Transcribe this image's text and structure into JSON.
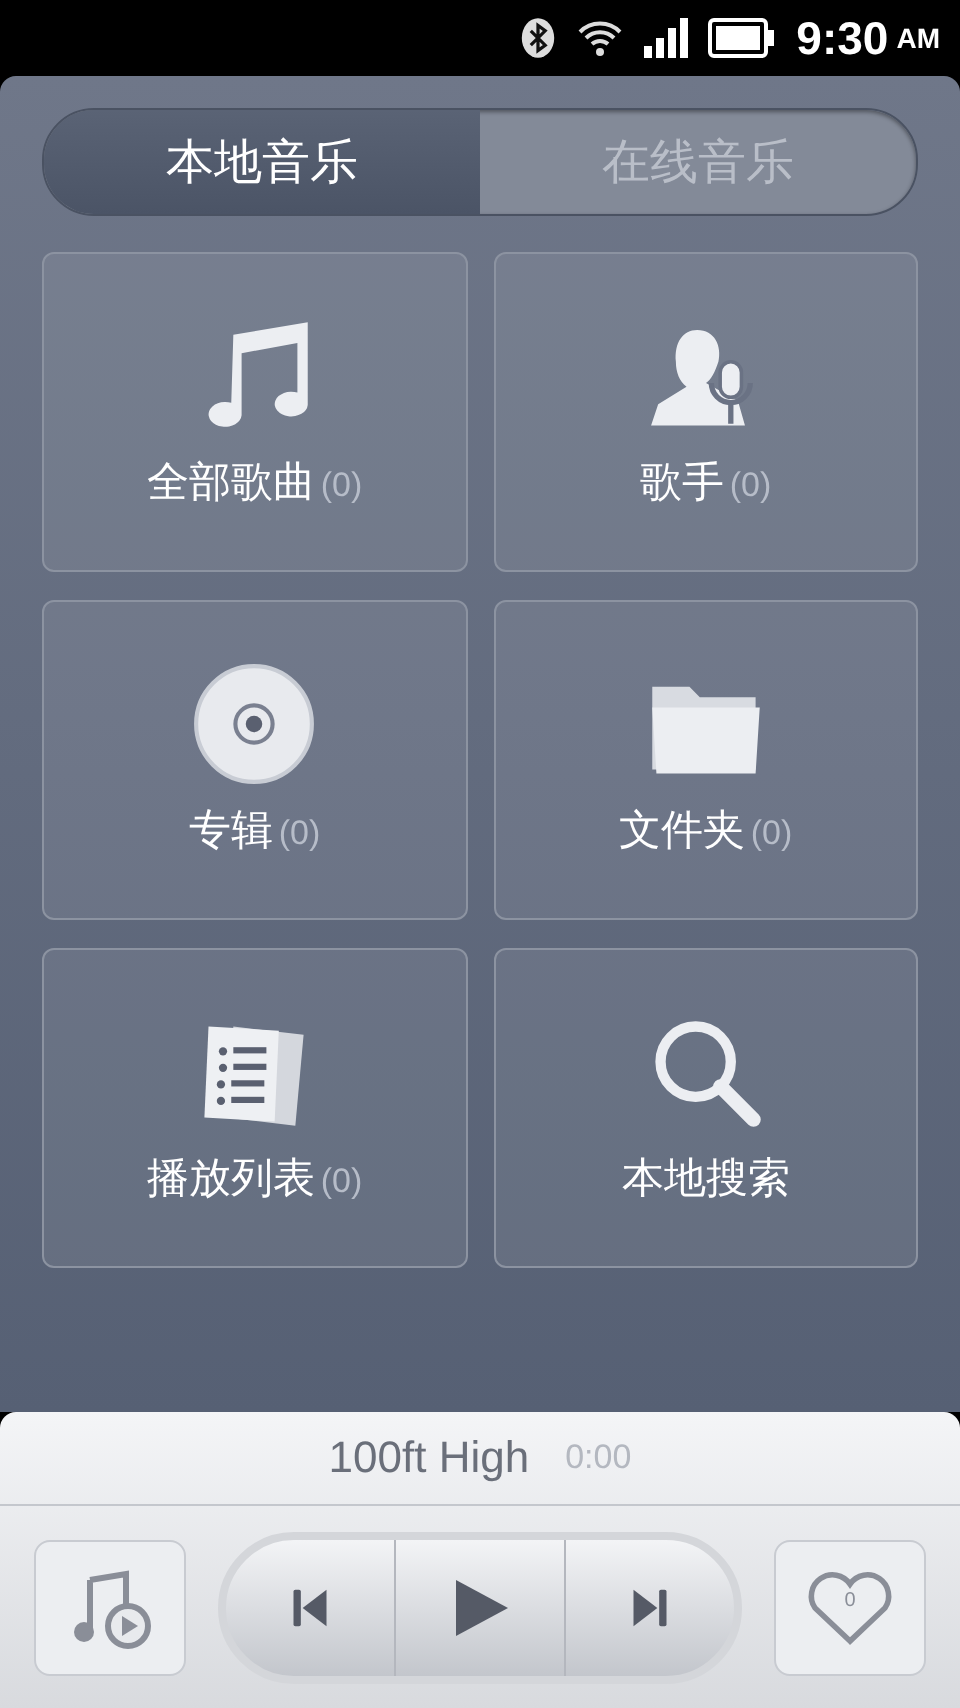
{
  "status_bar": {
    "time": "9:30",
    "ampm": "AM"
  },
  "tabs": [
    {
      "label": "本地音乐",
      "selected": true
    },
    {
      "label": "在线音乐",
      "selected": false
    }
  ],
  "tiles": [
    {
      "kind": "music",
      "label": "全部歌曲",
      "count": "(0)"
    },
    {
      "kind": "singer",
      "label": "歌手",
      "count": "(0)"
    },
    {
      "kind": "album",
      "label": "专辑",
      "count": "(0)"
    },
    {
      "kind": "folder",
      "label": "文件夹",
      "count": "(0)"
    },
    {
      "kind": "playlist",
      "label": "播放列表",
      "count": "(0)"
    },
    {
      "kind": "search",
      "label": "本地搜索"
    }
  ],
  "player": {
    "title": "100ft High",
    "time": "0:00",
    "favorites": "0"
  }
}
